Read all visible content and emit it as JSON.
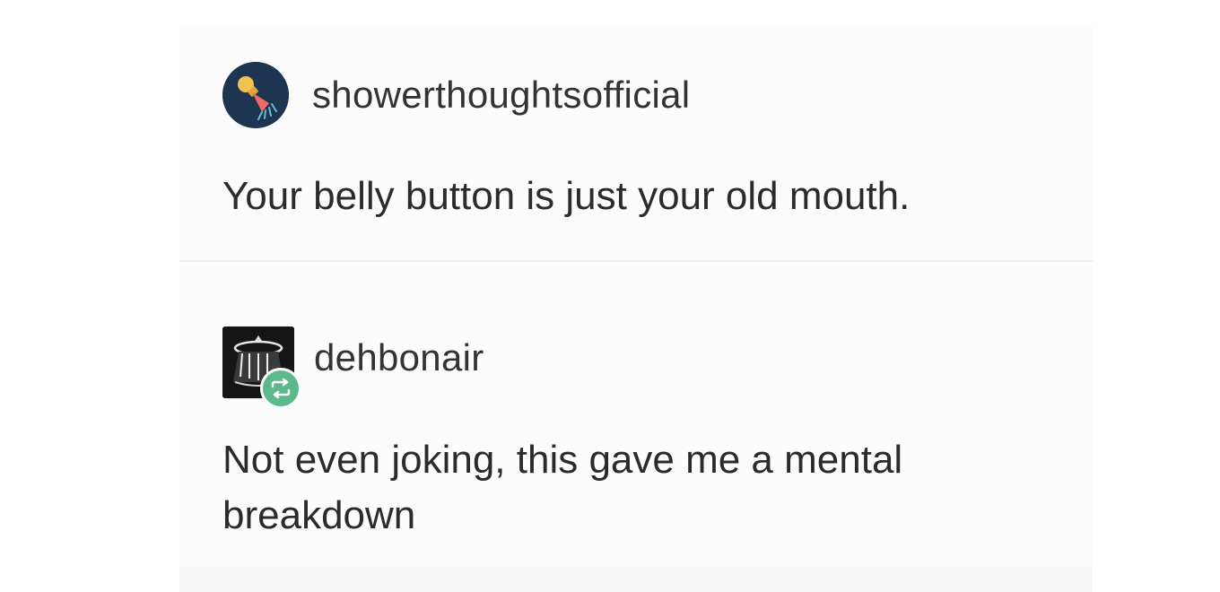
{
  "posts": [
    {
      "username": "showerthoughtsofficial",
      "text": "Your belly button is just your old mouth.",
      "avatar_icon": "lightbulb-shower-icon",
      "avatar_color": "#1d3550"
    },
    {
      "username": "dehbonair",
      "text": "Not even joking, this gave me a mental breakdown",
      "avatar_icon": "ufo-icon",
      "reblog_icon": "reblog-icon",
      "reblog_color": "#5bb98b"
    }
  ]
}
